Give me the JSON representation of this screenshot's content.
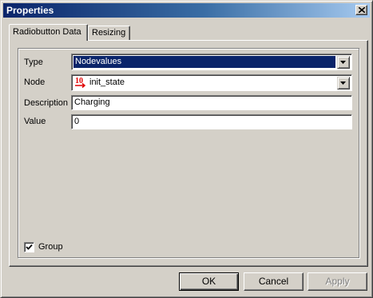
{
  "window": {
    "title": "Properties"
  },
  "tabs": [
    {
      "label": "Radiobutton Data",
      "active": true
    },
    {
      "label": "Resizing",
      "active": false
    }
  ],
  "form": {
    "type": {
      "label": "Type",
      "value": "Nodevalues"
    },
    "node": {
      "label": "Node",
      "value": "init_state",
      "icon": "node-variable-icon",
      "icon_text": "10"
    },
    "description": {
      "label": "Description",
      "value": "Charging"
    },
    "value": {
      "label": "Value",
      "value": "0"
    }
  },
  "group_checkbox": {
    "label": "Group",
    "checked": true
  },
  "buttons": {
    "ok": "OK",
    "cancel": "Cancel",
    "apply": "Apply"
  },
  "colors": {
    "titlebar": "#0a246a",
    "face": "#d4d0c8",
    "selection": "#0a246a",
    "icon_red": "#e00000"
  }
}
